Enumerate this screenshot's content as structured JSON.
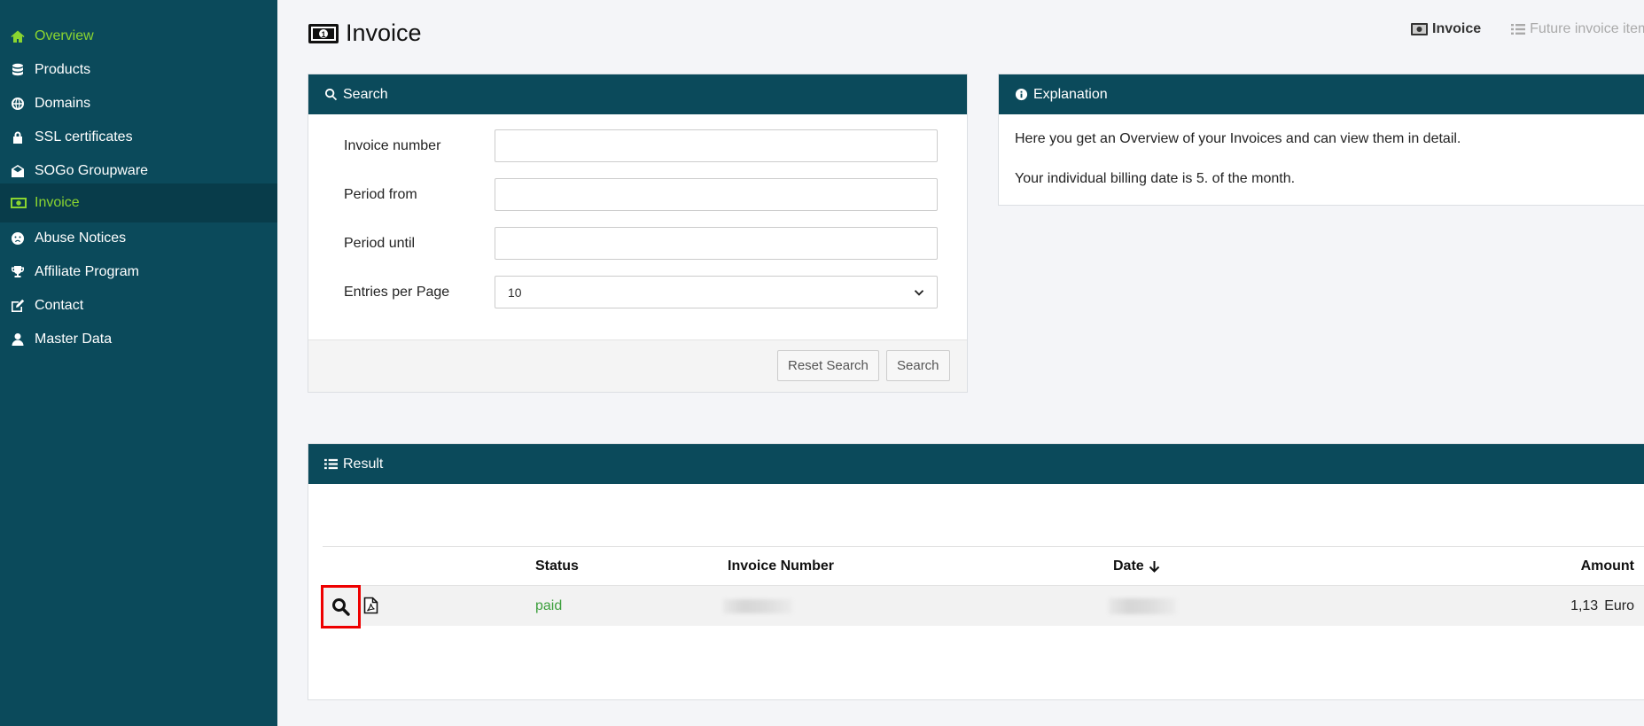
{
  "sidebar": {
    "items": [
      {
        "label": "Overview",
        "icon": "home-icon"
      },
      {
        "label": "Products",
        "icon": "database-icon"
      },
      {
        "label": "Domains",
        "icon": "globe-icon"
      },
      {
        "label": "SSL certificates",
        "icon": "lock-icon"
      },
      {
        "label": "SOGo Groupware",
        "icon": "envelope-open-icon"
      },
      {
        "label": "Invoice",
        "icon": "money-bill-icon"
      },
      {
        "label": "Abuse Notices",
        "icon": "frown-icon"
      },
      {
        "label": "Affiliate Program",
        "icon": "trophy-icon"
      },
      {
        "label": "Contact",
        "icon": "edit-icon"
      },
      {
        "label": "Master Data",
        "icon": "user-icon"
      }
    ],
    "active_color": "#8ad530",
    "background": "#0b4a5b"
  },
  "header": {
    "title": "Invoice",
    "tabs": [
      {
        "label": "Invoice",
        "icon": "money-bill-icon"
      },
      {
        "label": "Future invoice item",
        "icon": "list-icon"
      }
    ]
  },
  "search": {
    "title": "Search",
    "fields": {
      "invoice_number": {
        "label": "Invoice number",
        "value": "",
        "placeholder": ""
      },
      "period_from": {
        "label": "Period from",
        "value": "",
        "placeholder": ""
      },
      "period_until": {
        "label": "Period until",
        "value": "",
        "placeholder": ""
      },
      "entries_per_page": {
        "label": "Entries per Page",
        "value": "10"
      }
    },
    "reset_label": "Reset Search",
    "search_label": "Search"
  },
  "explanation": {
    "title": "Explanation",
    "line1": "Here you get an Overview of your Invoices and can view them in detail.",
    "line2": "Your individual billing date is 5. of the month."
  },
  "result": {
    "title": "Result",
    "columns": {
      "status": "Status",
      "invoice_number": "Invoice Number",
      "date": "Date",
      "amount": "Amount"
    },
    "rows": [
      {
        "status": "paid",
        "amount": "1,13",
        "currency": "Euro"
      }
    ]
  }
}
